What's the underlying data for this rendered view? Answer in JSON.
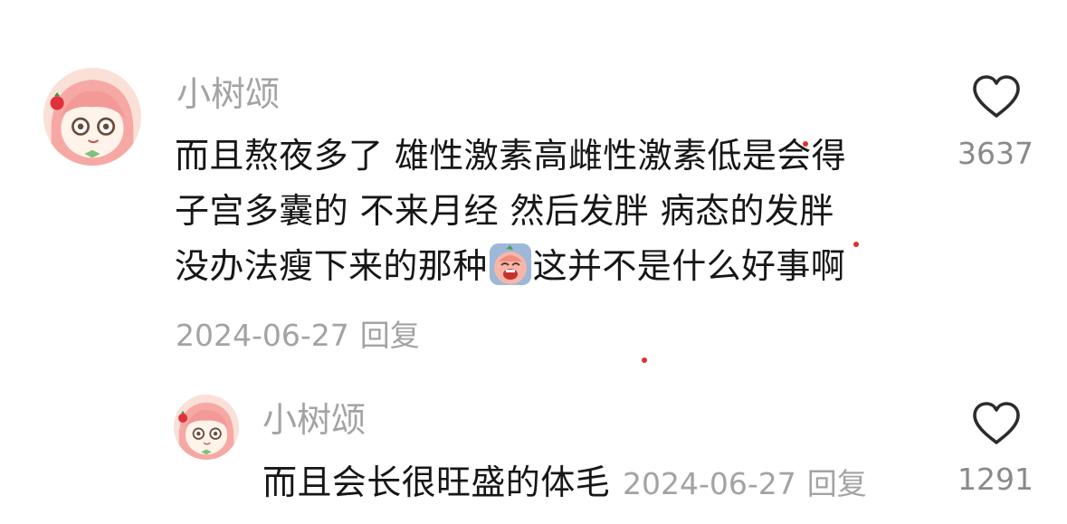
{
  "comment": {
    "username": "小树颂",
    "lines": [
      "而且熬夜多了 雄性激素高雌性激素低是会得",
      "子宫多囊的 不来月经 然后发胖 病态的发胖",
      "没办法瘦下来的那种",
      "这并不是什么好事啊"
    ],
    "date": "2024-06-27",
    "reply_label": "回复",
    "like_count": "3637",
    "sticker_icon": "crying-face-sticker-icon",
    "avatar_icon": "anime-girl-avatar-icon"
  },
  "reply": {
    "username": "小树颂",
    "text": "而且会长很旺盛的体毛",
    "date": "2024-06-27",
    "reply_label": "回复",
    "like_count": "1291",
    "avatar_icon": "anime-girl-avatar-icon"
  },
  "colors": {
    "muted_text": "#a3a3a3",
    "body_text": "#161616",
    "like_count": "#8a8a8a",
    "accent_dot": "#e0302c"
  },
  "icons": {
    "like": "heart-outline-icon"
  }
}
